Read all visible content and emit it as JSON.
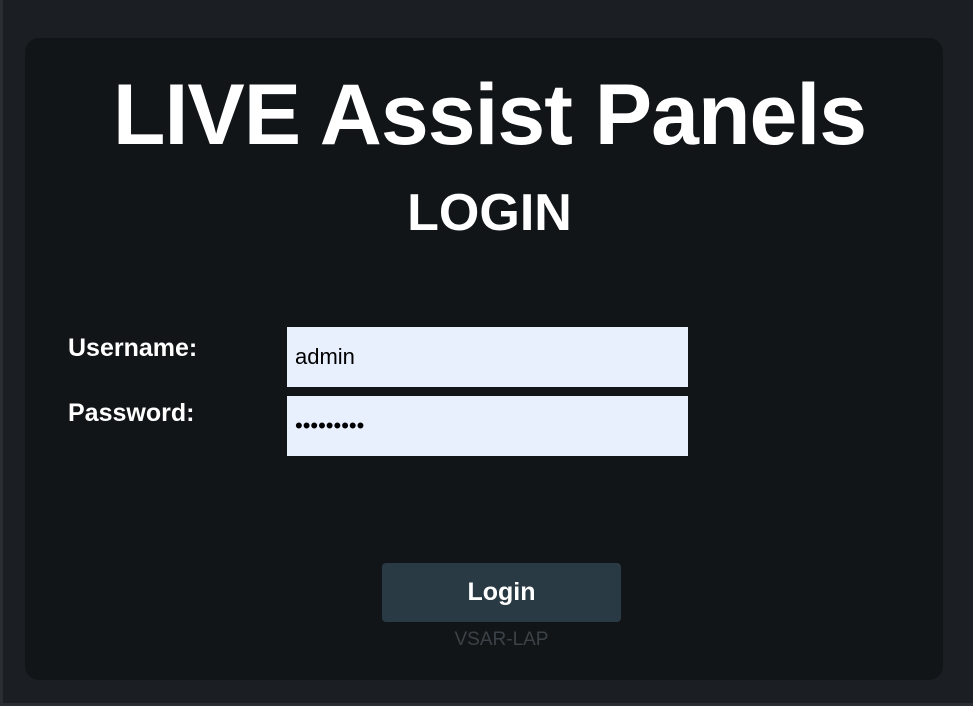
{
  "app": {
    "title": "LIVE Assist Panels",
    "subtitle": "LOGIN"
  },
  "form": {
    "username_label": "Username:",
    "username_value": "admin",
    "password_label": "Password:",
    "password_value": "password1",
    "login_button_label": "Login"
  },
  "footer": {
    "hostname": "VSAR-LAP"
  },
  "colors": {
    "background": "#15181c",
    "panel": "#121518",
    "input_background": "#e8f0fe",
    "button_background": "#2a3a45",
    "text": "#ffffff",
    "muted_text": "#3b4247"
  }
}
